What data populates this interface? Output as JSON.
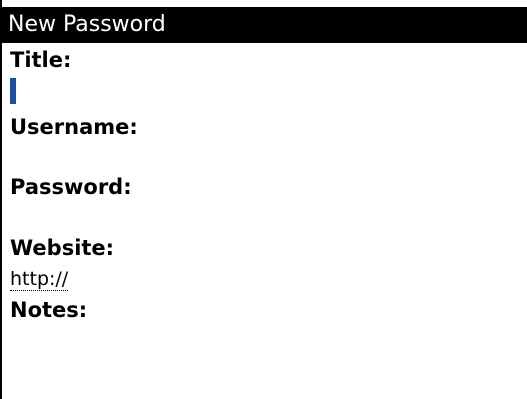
{
  "screen": {
    "title": "New Password"
  },
  "form": {
    "title_label": "Title:",
    "title_value": "",
    "username_label": "Username:",
    "username_value": "",
    "password_label": "Password:",
    "password_value": "",
    "website_label": "Website:",
    "website_value": "http://",
    "notes_label": "Notes:",
    "notes_value": ""
  },
  "colors": {
    "title_bar_bg": "#000000",
    "title_bar_text": "#ffffff",
    "cursor": "#1d4ea8"
  }
}
